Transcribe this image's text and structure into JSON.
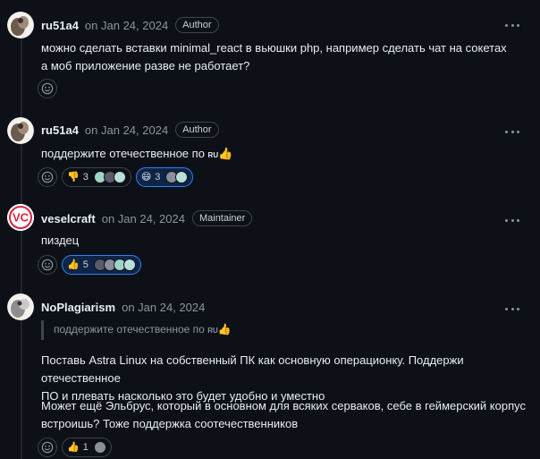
{
  "comments": [
    {
      "author": "ru51a4",
      "date": "on Jan 24, 2024",
      "badge": "Author",
      "lines": [
        "можно сделать вставки minimal_react в вьюшки php, например сделать чат на сокетах",
        "а моб приложение разве не работает?"
      ]
    },
    {
      "author": "ru51a4",
      "date": "on Jan 24, 2024",
      "badge": "Author",
      "text": "поддержите отечественное по",
      "ru": "RU",
      "reactions": [
        {
          "emoji": "👎",
          "count": "3"
        },
        {
          "emoji": "😄",
          "count": "3"
        }
      ]
    },
    {
      "author": "veselcraft",
      "date": "on Jan 24, 2024",
      "badge": "Maintainer",
      "text": "пиздец",
      "reactions": [
        {
          "emoji": "👍",
          "count": "5"
        }
      ]
    },
    {
      "author": "NoPlagiarism",
      "date": "on Jan 24, 2024",
      "quote": "поддержите отечественное по",
      "quote_ru": "RU",
      "para1": [
        "Поставь Astra Linux на собственный ПК как основную операционку. Поддержи отечественное",
        "ПО и плевать насколько это будет удобно и уместно"
      ],
      "para2": [
        "Может ещё Эльбрус, который в основном для всяких серваков, себе в геймерский корпус",
        "встроишь? Тоже поддержка соотечественников"
      ],
      "reactions": [
        {
          "emoji": "👍",
          "count": "1"
        }
      ]
    }
  ],
  "colors": {
    "background": "#0d1117",
    "text": "#e6edf3",
    "muted": "#8b949e",
    "border": "#3d444d",
    "accent": "#2f81f7"
  },
  "icons": {
    "more": "kebab-horizontal-icon",
    "add_reaction": "smiley-icon"
  }
}
